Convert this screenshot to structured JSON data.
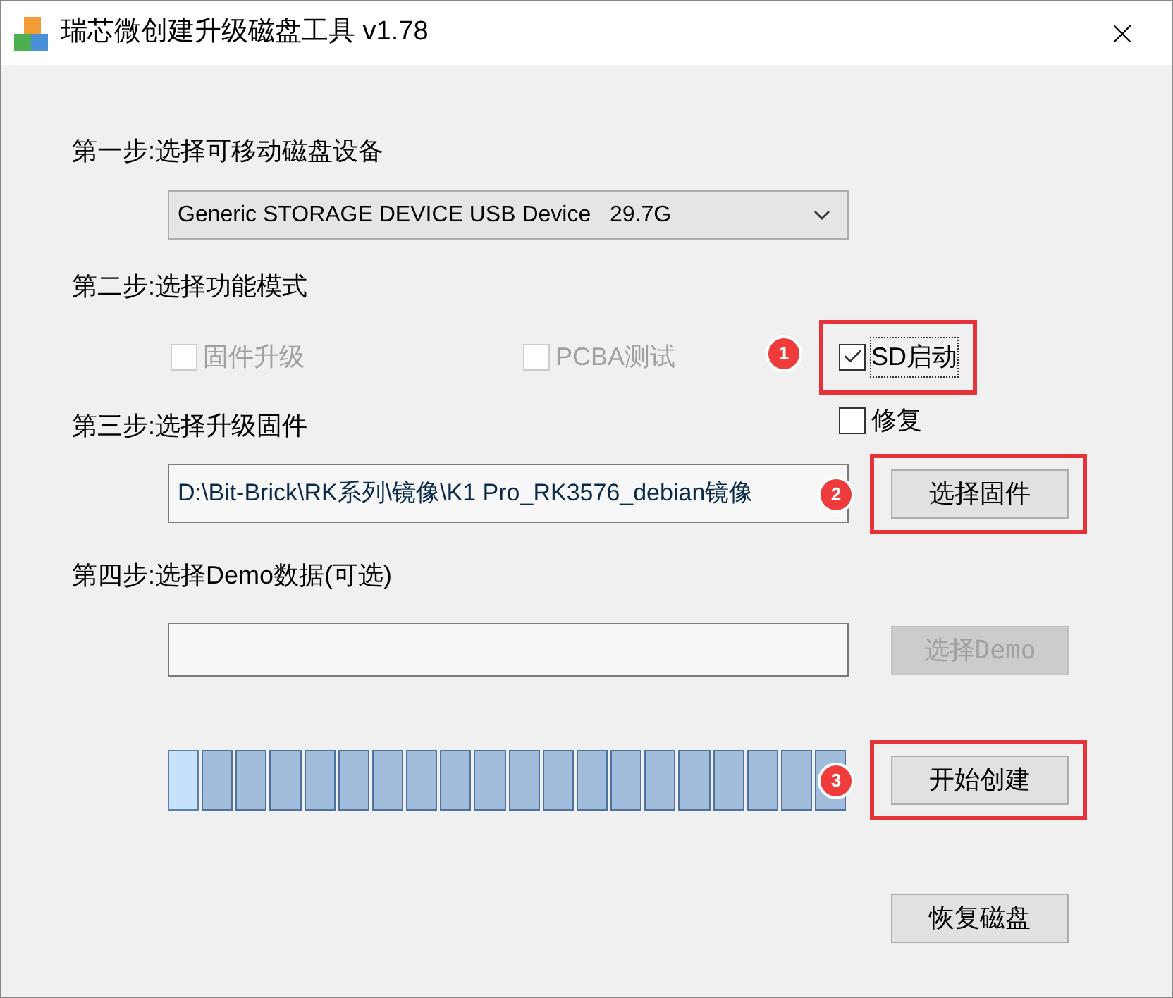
{
  "window": {
    "title": "瑞芯微创建升级磁盘工具 v1.78"
  },
  "step1": {
    "label": "第一步:选择可移动磁盘设备",
    "device": "Generic STORAGE DEVICE USB Device   29.7G"
  },
  "step2": {
    "label": "第二步:选择功能模式",
    "options": [
      {
        "label": "固件升级",
        "checked": false,
        "disabled": true
      },
      {
        "label": "PCBA测试",
        "checked": false,
        "disabled": true
      },
      {
        "label": "SD启动",
        "checked": true,
        "disabled": false,
        "marker": "1"
      },
      {
        "label": "修复",
        "checked": false,
        "disabled": false
      }
    ]
  },
  "step3": {
    "label": "第三步:选择升级固件",
    "path": "D:\\Bit-Brick\\RK系列\\镜像\\K1 Pro_RK3576_debian镜像",
    "button": {
      "label": "选择固件",
      "disabled": false,
      "marker": "2"
    }
  },
  "step4": {
    "label": "第四步:选择Demo数据(可选)",
    "button": {
      "label": "选择Demo",
      "disabled": true
    }
  },
  "progress": {
    "level": 1
  },
  "start_button": {
    "label": "开始创建",
    "disabled": false,
    "marker": "3"
  },
  "restore_button": {
    "label": "恢复磁盘",
    "disabled": false
  }
}
